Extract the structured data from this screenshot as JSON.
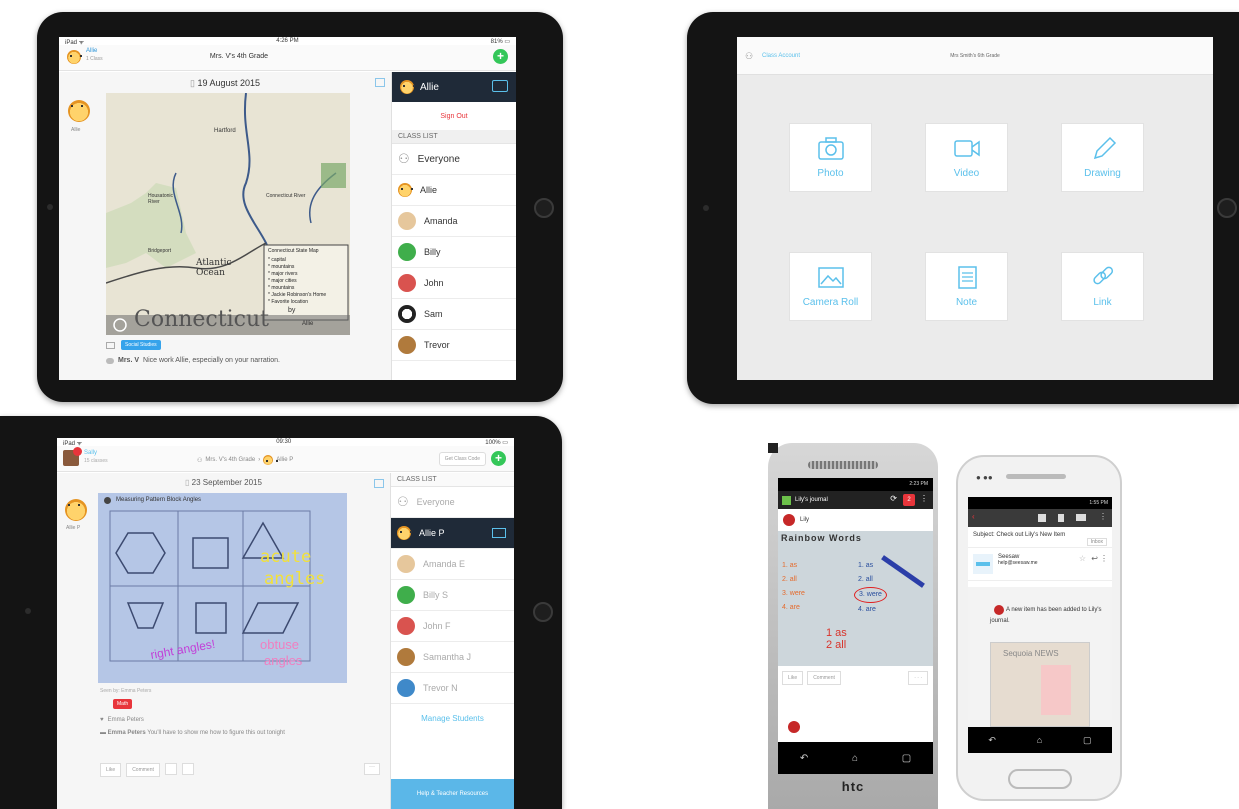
{
  "tl": {
    "status": {
      "left": "iPad ᯤ",
      "time": "4:26 PM",
      "right": "81% ▭"
    },
    "user": {
      "name": "Allie",
      "sub": "1 Class"
    },
    "class_title": "Mrs. V's 4th Grade",
    "date": "19 August 2015",
    "post_author": "Allie",
    "map_labels": {
      "hartford": "Hartford",
      "housatonic": "Housatonic River",
      "connecticut": "Connecticut River",
      "bridgeport": "Bridgeport",
      "atlantic": "Atlantic Ocean",
      "legend_title": "Connecticut State Map",
      "legend_1": "* capital",
      "legend_2": "* mountains",
      "legend_3": "* major rivers",
      "legend_4": "* major cities",
      "legend_5": "* mountains",
      "legend_6": "* Jackie Robinson's Home",
      "legend_7": "* Favorite location",
      "bottom_word": "Connecticut",
      "by": "by",
      "signature": "Allie"
    },
    "tag": "Social Studies",
    "comment_author": "Mrs. V",
    "comment_text": "Nice work Allie, especially on your narration.",
    "side": {
      "header": "Allie",
      "signout": "Sign Out",
      "class_list": "CLASS LIST",
      "students": [
        "Everyone",
        "Allie",
        "Amanda",
        "Billy",
        "John",
        "Sam",
        "Trevor"
      ]
    }
  },
  "tr": {
    "left": "Class Account",
    "title": "Mrs Smith's 6th Grade",
    "tiles": [
      "Photo",
      "Video",
      "Drawing",
      "Camera Roll",
      "Note",
      "Link"
    ]
  },
  "bl": {
    "status": {
      "left": "iPad ᯤ",
      "time": "09:30",
      "right": "100% ▭"
    },
    "user": {
      "name": "Sally",
      "sub": "15 classes"
    },
    "class_title": "Mrs. V's 4th Grade",
    "student_title": "Allie P",
    "button": "Get Class Code",
    "date": "23 September 2015",
    "author": "Allie P",
    "worksheet_title": "Measuring Pattern Block Angles",
    "ink": {
      "acute": "acute",
      "angles1": "angles",
      "right": "right angles!",
      "obtuse": "obtuse",
      "angles2": "angles"
    },
    "meta": "Seen by: Emma Peters",
    "tag": "Math",
    "like_name": "Emma Peters",
    "comment_author": "Emma Peters",
    "comment_text": "You'll have to show me how to figure this out tonight",
    "actions": [
      "Like",
      "Comment"
    ],
    "side": {
      "class_list": "CLASS LIST",
      "students": [
        "Everyone",
        "Allie P",
        "Amanda E",
        "Billy S",
        "John F",
        "Samantha J",
        "Trevor N"
      ],
      "manage": "Manage Students",
      "help": "Help & Teacher Resources"
    }
  },
  "phone1": {
    "app_title": "Lily's journal",
    "badge": "2",
    "user": "Lily",
    "sheet_title": "Rainbow Words",
    "words": [
      "1. as",
      "2. all",
      "3. were",
      "4. are"
    ],
    "right_words": [
      "1. as",
      "2. all",
      "3. were",
      "4. are"
    ],
    "big": [
      "1 as",
      "2 all"
    ],
    "actions": [
      "Like",
      "Comment",
      "· · ·"
    ],
    "brand": "htc",
    "time": "2:23 PM"
  },
  "phone2": {
    "time": "1:55 PM",
    "subject_label": "Subject:",
    "subject": "Check out Lily's New Item",
    "inbox": "Inbox",
    "from_name": "Seesaw",
    "from_email": "help@seesaw.me",
    "message": "A new item has been added to Lily's journal.",
    "card": "Sequoia NEWS"
  }
}
